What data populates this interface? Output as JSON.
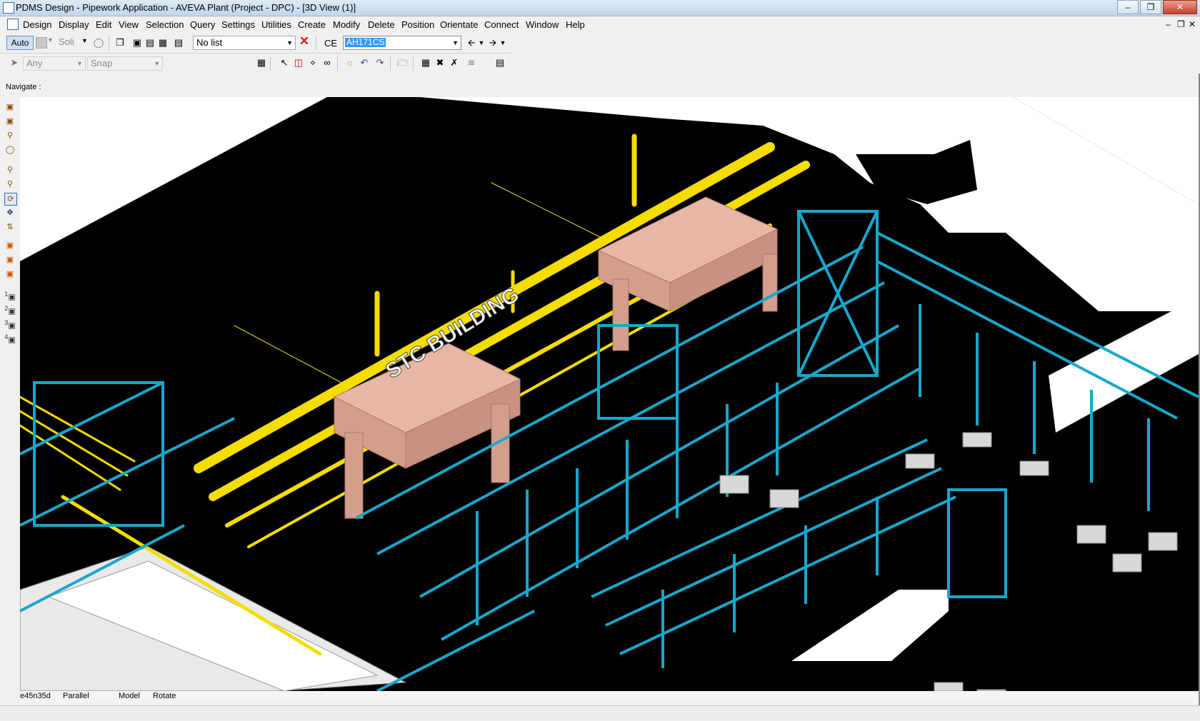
{
  "window": {
    "title": "PDMS Design - Pipework Application -  AVEVA Plant (Project - DPC) - [3D View (1)]",
    "minimize_icon": "minimize-icon",
    "maximize_icon": "restore-icon",
    "close_icon": "close-icon"
  },
  "menu": {
    "items": [
      "Design",
      "Display",
      "Edit",
      "View",
      "Selection",
      "Query",
      "Settings",
      "Utilities",
      "Create",
      "Modify",
      "Delete",
      "Position",
      "Orientate",
      "Connect",
      "Window",
      "Help"
    ]
  },
  "toolbar1": {
    "auto_label": "Auto",
    "style_label": "Soli",
    "list_value": "No list",
    "ce_label": "CE",
    "ce_value": "AH171CS"
  },
  "toolbar2": {
    "pick_filter": "Any",
    "snap": "Snap"
  },
  "navigate": {
    "label": "Navigate :"
  },
  "left_tools": {
    "numbers": [
      "1",
      "2",
      "3",
      "4"
    ]
  },
  "scene": {
    "building_label": "STC BUILDING",
    "colors": {
      "background": "#000000",
      "structure": "#19a7cc",
      "pipes": "#f5dd00",
      "equipment": "#e8b6a5",
      "ground": "#ffffff",
      "foundations": "#d8d8d8"
    }
  },
  "status": {
    "direction": "e45n35d",
    "projection": "Parallel",
    "mode": "Model",
    "action": "Rotate"
  }
}
